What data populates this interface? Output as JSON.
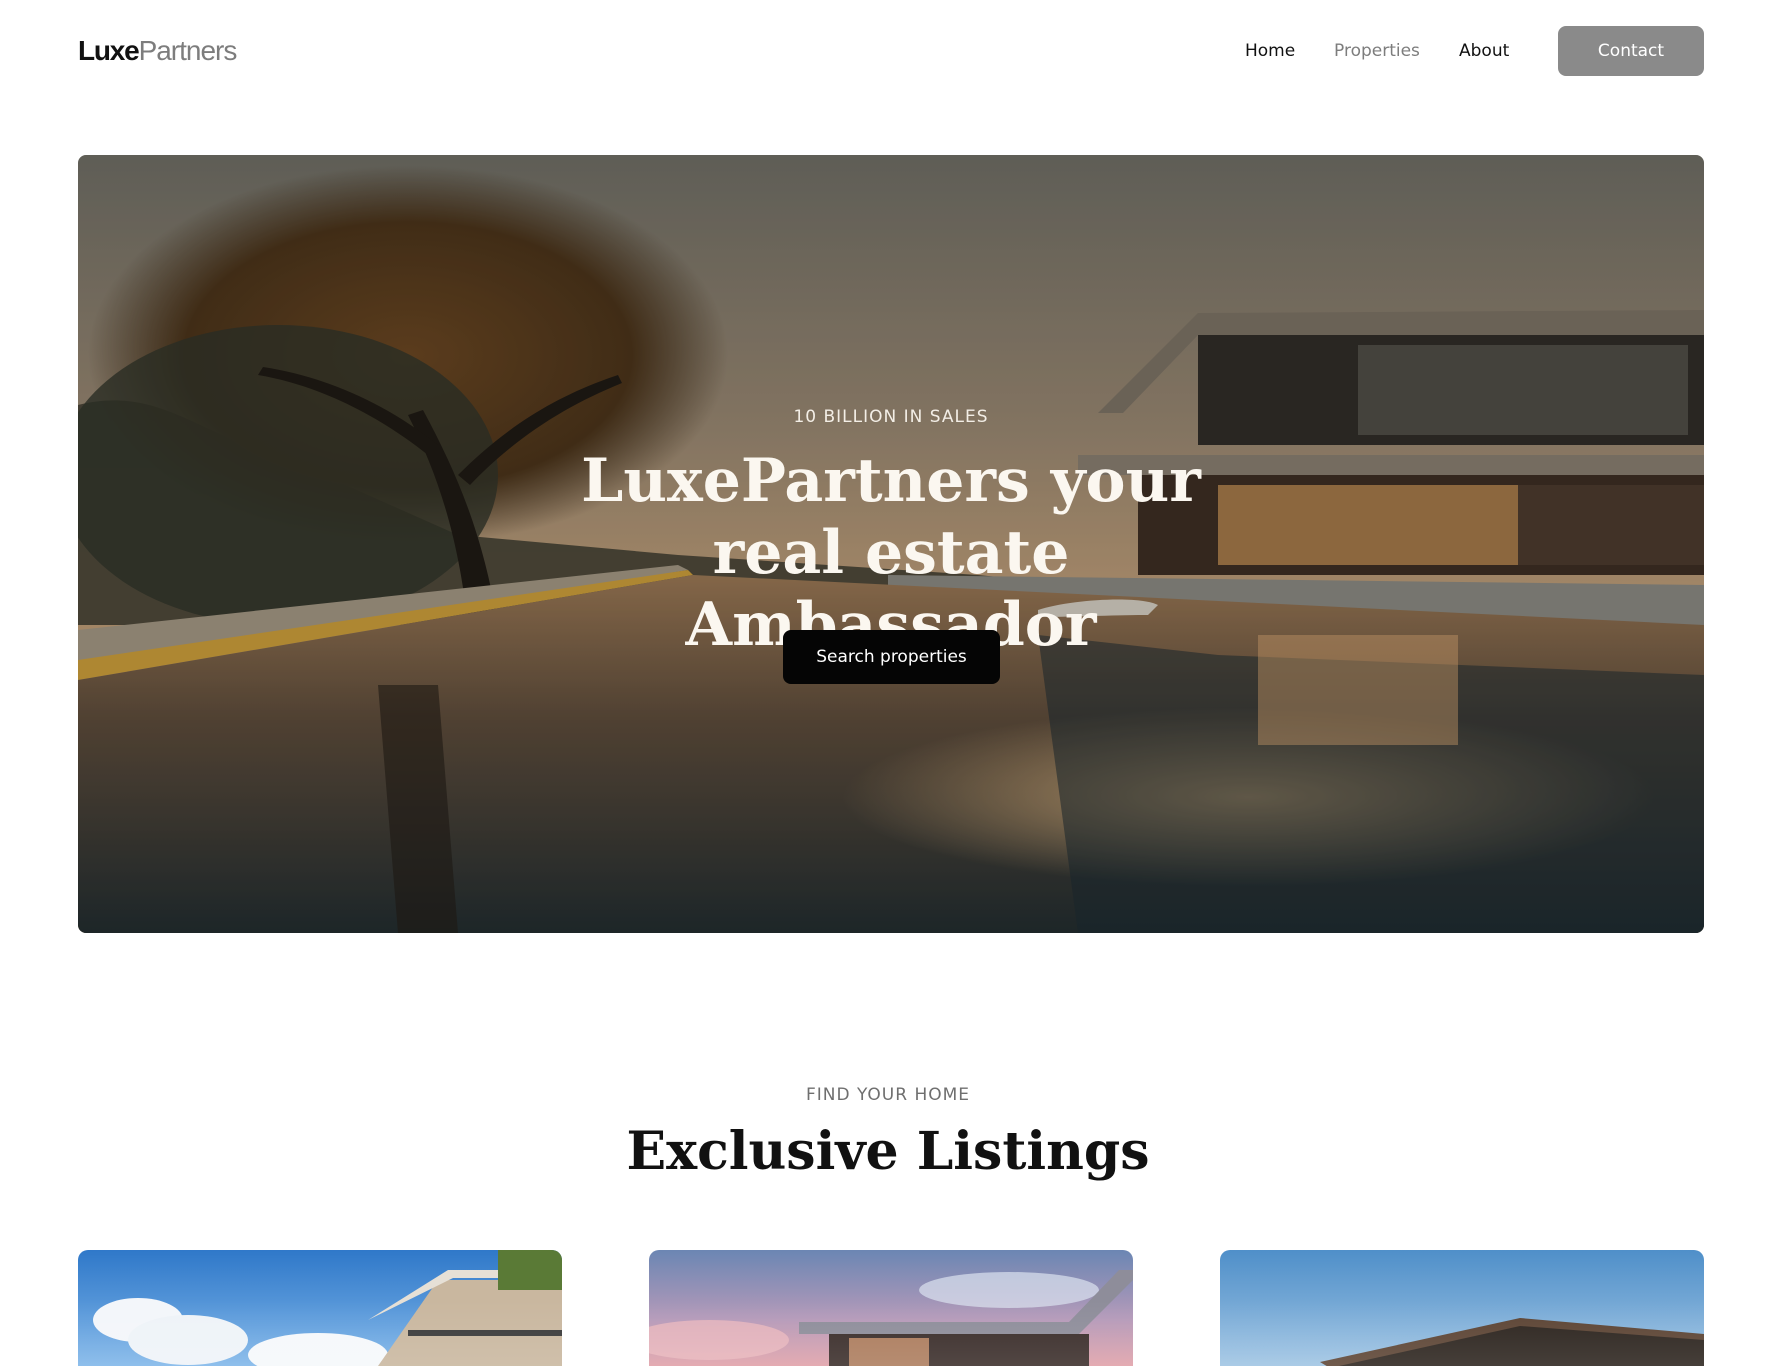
{
  "header": {
    "logo_part1": "Luxe",
    "logo_part2": "Partners",
    "nav": {
      "home": "Home",
      "properties": "Properties",
      "about": "About"
    },
    "contact_label": "Contact"
  },
  "hero": {
    "kicker": "10 BILLION IN SALES",
    "title": "LuxePartners your real estate Ambassador",
    "cta_label": "Search properties"
  },
  "listings": {
    "kicker": "FIND YOUR HOME",
    "title": "Exclusive Listings"
  },
  "colors": {
    "accent_dark": "#050505",
    "contact_button": "#8a8a8a",
    "muted_text": "#7d7d7d"
  },
  "icons": {
    "hero_image": "modern-villa-pool-sunset-image",
    "card_images": [
      "villa-blue-sky-image",
      "villa-pink-sunset-image",
      "villa-clear-sky-image"
    ]
  }
}
